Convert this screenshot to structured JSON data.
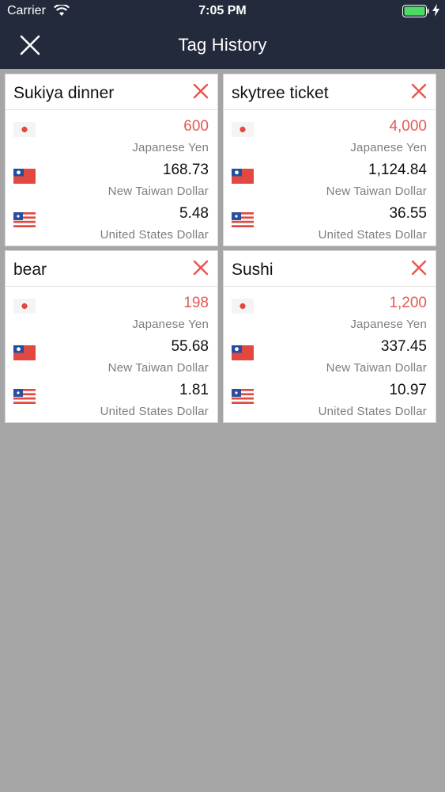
{
  "status_bar": {
    "carrier": "Carrier",
    "time": "7:05 PM"
  },
  "nav": {
    "title": "Tag History"
  },
  "colors": {
    "nav_bg": "#222a3b",
    "base_amount": "#e35a55",
    "delete": "#e85550",
    "background": "#a5a5a6"
  },
  "cards": [
    {
      "title": "Sukiya dinner",
      "rows": [
        {
          "flag": "japan-flag-icon",
          "amount": "600",
          "currency": "Japanese Yen",
          "base": true
        },
        {
          "flag": "taiwan-flag-icon",
          "amount": "168.73",
          "currency": "New Taiwan Dollar",
          "base": false
        },
        {
          "flag": "us-flag-icon",
          "amount": "5.48",
          "currency": "United States Dollar",
          "base": false
        }
      ]
    },
    {
      "title": "skytree ticket",
      "rows": [
        {
          "flag": "japan-flag-icon",
          "amount": "4,000",
          "currency": "Japanese Yen",
          "base": true
        },
        {
          "flag": "taiwan-flag-icon",
          "amount": "1,124.84",
          "currency": "New Taiwan Dollar",
          "base": false
        },
        {
          "flag": "us-flag-icon",
          "amount": "36.55",
          "currency": "United States Dollar",
          "base": false
        }
      ]
    },
    {
      "title": "bear",
      "rows": [
        {
          "flag": "japan-flag-icon",
          "amount": "198",
          "currency": "Japanese Yen",
          "base": true
        },
        {
          "flag": "taiwan-flag-icon",
          "amount": "55.68",
          "currency": "New Taiwan Dollar",
          "base": false
        },
        {
          "flag": "us-flag-icon",
          "amount": "1.81",
          "currency": "United States Dollar",
          "base": false
        }
      ]
    },
    {
      "title": "Sushi",
      "rows": [
        {
          "flag": "japan-flag-icon",
          "amount": "1,200",
          "currency": "Japanese Yen",
          "base": true
        },
        {
          "flag": "taiwan-flag-icon",
          "amount": "337.45",
          "currency": "New Taiwan Dollar",
          "base": false
        },
        {
          "flag": "us-flag-icon",
          "amount": "10.97",
          "currency": "United States Dollar",
          "base": false
        }
      ]
    }
  ]
}
